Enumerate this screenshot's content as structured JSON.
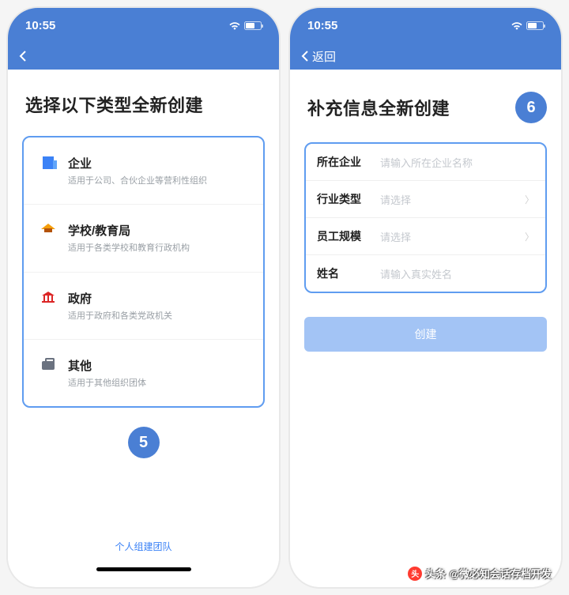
{
  "statusTime": "10:55",
  "screen1": {
    "title": "选择以下类型全新创建",
    "types": [
      {
        "name": "企业",
        "desc": "适用于公司、合伙企业等营利性组织"
      },
      {
        "name": "学校/教育局",
        "desc": "适用于各类学校和教育行政机构"
      },
      {
        "name": "政府",
        "desc": "适用于政府和各类党政机关"
      },
      {
        "name": "其他",
        "desc": "适用于其他组织团体"
      }
    ],
    "step": "5",
    "footerLink": "个人组建团队"
  },
  "screen2": {
    "navBack": "返回",
    "title": "补充信息全新创建",
    "step": "6",
    "fields": [
      {
        "label": "所在企业",
        "placeholder": "请输入所在企业名称",
        "hasChevron": false
      },
      {
        "label": "行业类型",
        "placeholder": "请选择",
        "hasChevron": true
      },
      {
        "label": "员工规模",
        "placeholder": "请选择",
        "hasChevron": true
      },
      {
        "label": "姓名",
        "placeholder": "请输入真实姓名",
        "hasChevron": false
      }
    ],
    "createButton": "创建"
  },
  "watermark": "@微必知会话存档开发",
  "watermarkPrefix": "头条"
}
